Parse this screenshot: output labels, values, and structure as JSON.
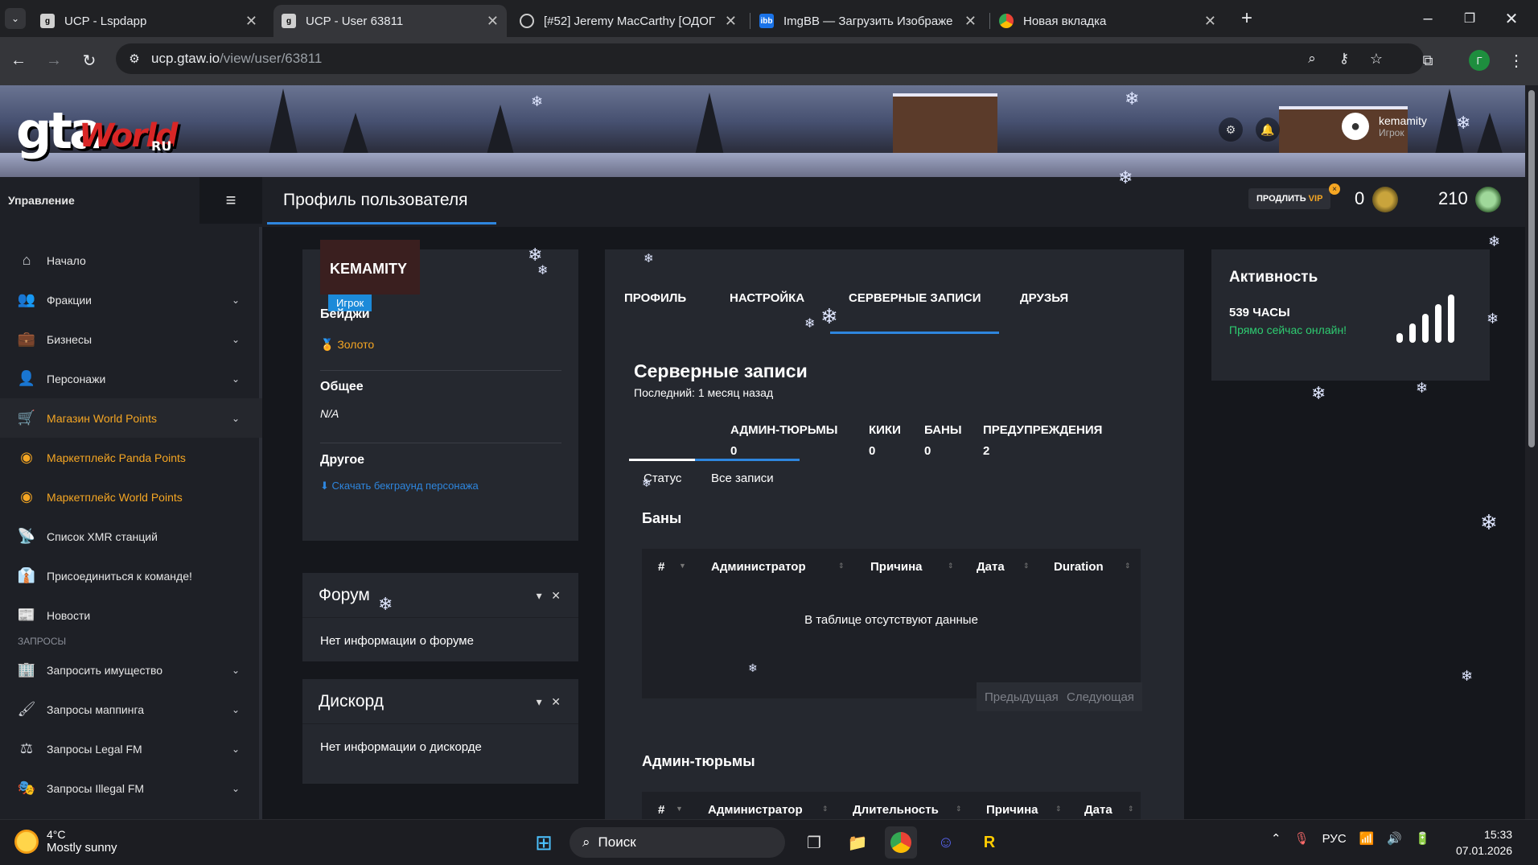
{
  "browser": {
    "tabs": [
      {
        "title": "UCP - Lspdapp",
        "active": false
      },
      {
        "title": "UCP - User 63811",
        "active": true
      },
      {
        "title": "[#52] Jeremy MacCarthy [ОДОГ",
        "active": false
      },
      {
        "title": "ImgBB — Загрузить Изображе",
        "active": false
      },
      {
        "title": "Новая вкладка",
        "active": false
      }
    ],
    "url_host": "ucp.gtaw.io",
    "url_path": "/view/user/63811",
    "profile_initial": "Г"
  },
  "site": {
    "logo_main": "gta",
    "logo_world": "World",
    "logo_ru": "RU",
    "user_name": "kemamity",
    "user_role": "Игрок",
    "sidebar_title": "Управление",
    "page_title": "Профиль пользователя",
    "vip_text": "ПРОДЛИТЬ",
    "vip_badge": "VIP",
    "points_a": "0",
    "points_b": "210"
  },
  "sidebar": {
    "items": [
      {
        "label": "Начало",
        "icon": "home-icon"
      },
      {
        "label": "Фракции",
        "icon": "users-icon"
      },
      {
        "label": "Бизнесы",
        "icon": "briefcase-icon"
      },
      {
        "label": "Персонажи",
        "icon": "user-icon"
      },
      {
        "label": "Магазин World Points",
        "icon": "cart-icon"
      },
      {
        "label": "Маркетплейс Panda Points",
        "icon": "coins-icon"
      },
      {
        "label": "Маркетплейс World Points",
        "icon": "coins-icon"
      },
      {
        "label": "Список XMR станций",
        "icon": "antenna-icon"
      },
      {
        "label": "Присоединиться к команде!",
        "icon": "user-tie-icon"
      },
      {
        "label": "Новости",
        "icon": "newspaper-icon"
      }
    ],
    "section_requests": "ЗАПРОСЫ",
    "request_items": [
      {
        "label": "Запросить имущество",
        "icon": "building-icon"
      },
      {
        "label": "Запросы маппинга",
        "icon": "brush-icon"
      },
      {
        "label": "Запросы Legal FM",
        "icon": "scale-icon"
      },
      {
        "label": "Запросы Illegal FM",
        "icon": "mask-icon"
      }
    ]
  },
  "profile": {
    "name": "KEMAMITY",
    "role": "Игрок",
    "badges_label": "Бейджи",
    "badge_value": "Золото",
    "general_label": "Общее",
    "general_value": "N/A",
    "other_label": "Другое",
    "download_link": "Скачать бекграунд персонажа"
  },
  "forum": {
    "title": "Форум",
    "body": "Нет информации о форуме"
  },
  "discord": {
    "title": "Дискорд",
    "body": "Нет информации о дискорде"
  },
  "records": {
    "tabs": [
      "ПРОФИЛЬ",
      "НАСТРОЙКА",
      "СЕРВЕРНЫЕ ЗАПИСИ",
      "ДРУЗЬЯ"
    ],
    "title": "Серверные записи",
    "last": "Последний: 1 месяц назад",
    "stats": [
      {
        "label": "АДМИН-ТЮРЬМЫ",
        "value": "0"
      },
      {
        "label": "КИКИ",
        "value": "0"
      },
      {
        "label": "БАНЫ",
        "value": "0"
      },
      {
        "label": "ПРЕДУПРЕЖДЕНИЯ",
        "value": "2"
      }
    ],
    "subtabs": [
      "Статус",
      "Все записи"
    ],
    "bans_title": "Баны",
    "bans_columns": [
      "#",
      "Администратор",
      "Причина",
      "Дата",
      "Duration"
    ],
    "empty_text": "В таблице отсутствуют данные",
    "prev": "Предыдущая",
    "next": "Следующая",
    "jail_title": "Админ-тюрьмы",
    "jail_columns": [
      "#",
      "Администратор",
      "Длительность",
      "Причина",
      "Дата"
    ]
  },
  "activity": {
    "title": "Активность",
    "hours": "539 ЧАСЫ",
    "status": "Прямо сейчас онлайн!"
  },
  "taskbar": {
    "weather_temp": "4°C",
    "weather_desc": "Mostly sunny",
    "search_placeholder": "Поиск",
    "lang": "РУС",
    "time": "15:33",
    "date": "07.01.2026"
  },
  "colors": {
    "accent": "#2e86de",
    "gold": "#f5a623",
    "online": "#2ecc71"
  }
}
